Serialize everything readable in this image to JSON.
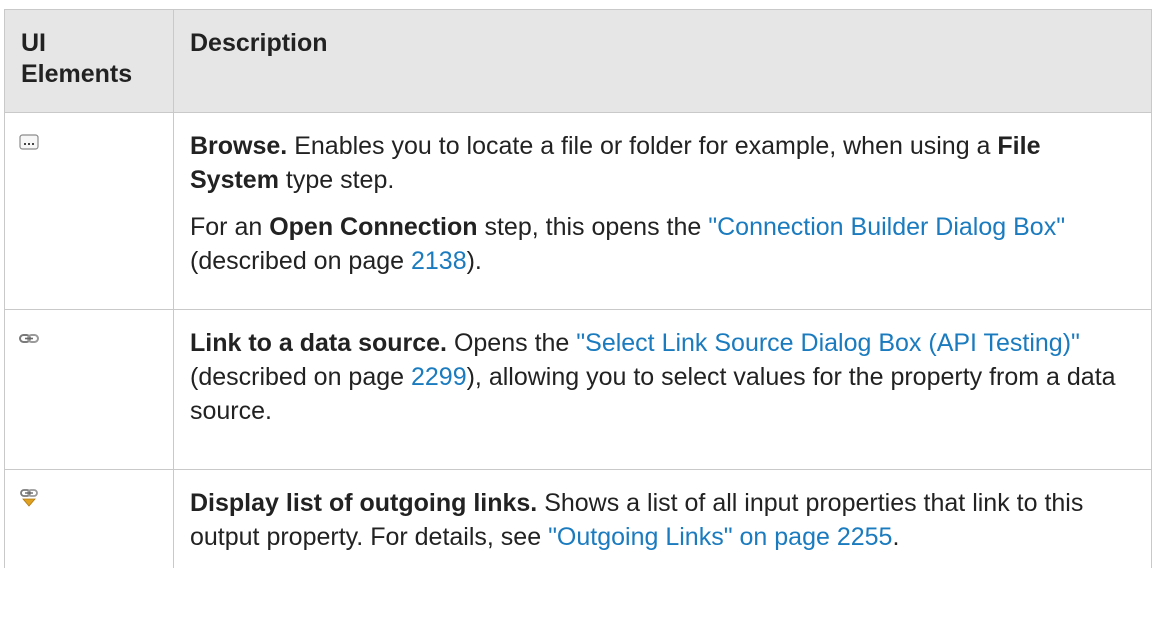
{
  "table": {
    "headers": {
      "ui_elements": "UI Elements",
      "description": "Description"
    },
    "rows": [
      {
        "icon": "browse-ellipsis-icon",
        "paragraphs": [
          {
            "term": "Browse.",
            "text1": " Enables you to locate a file or folder for example, when using a ",
            "term2": "File System",
            "text2": " type step."
          },
          {
            "pre": "For an ",
            "term": "Open Connection",
            "text1": " step, this opens the ",
            "link": "\"Connection Builder Dialog Box\"",
            "text2": " (described on page ",
            "page": "2138",
            "text3": ")."
          }
        ]
      },
      {
        "icon": "chain-link-icon",
        "term": "Link to a data source.",
        "text1": " Opens the ",
        "link": "\"Select Link Source Dialog Box (API Testing)\"",
        "text2": " (described on page ",
        "page": "2299",
        "text3": "), allowing you to select values for the property from a data source."
      },
      {
        "icon": "outgoing-links-icon",
        "term": "Display list of outgoing links.",
        "text1": " Shows a list of all input properties that link to this output property. For details, see ",
        "link": "\"Outgoing Links\" on page 2255",
        "text2": "."
      }
    ]
  }
}
